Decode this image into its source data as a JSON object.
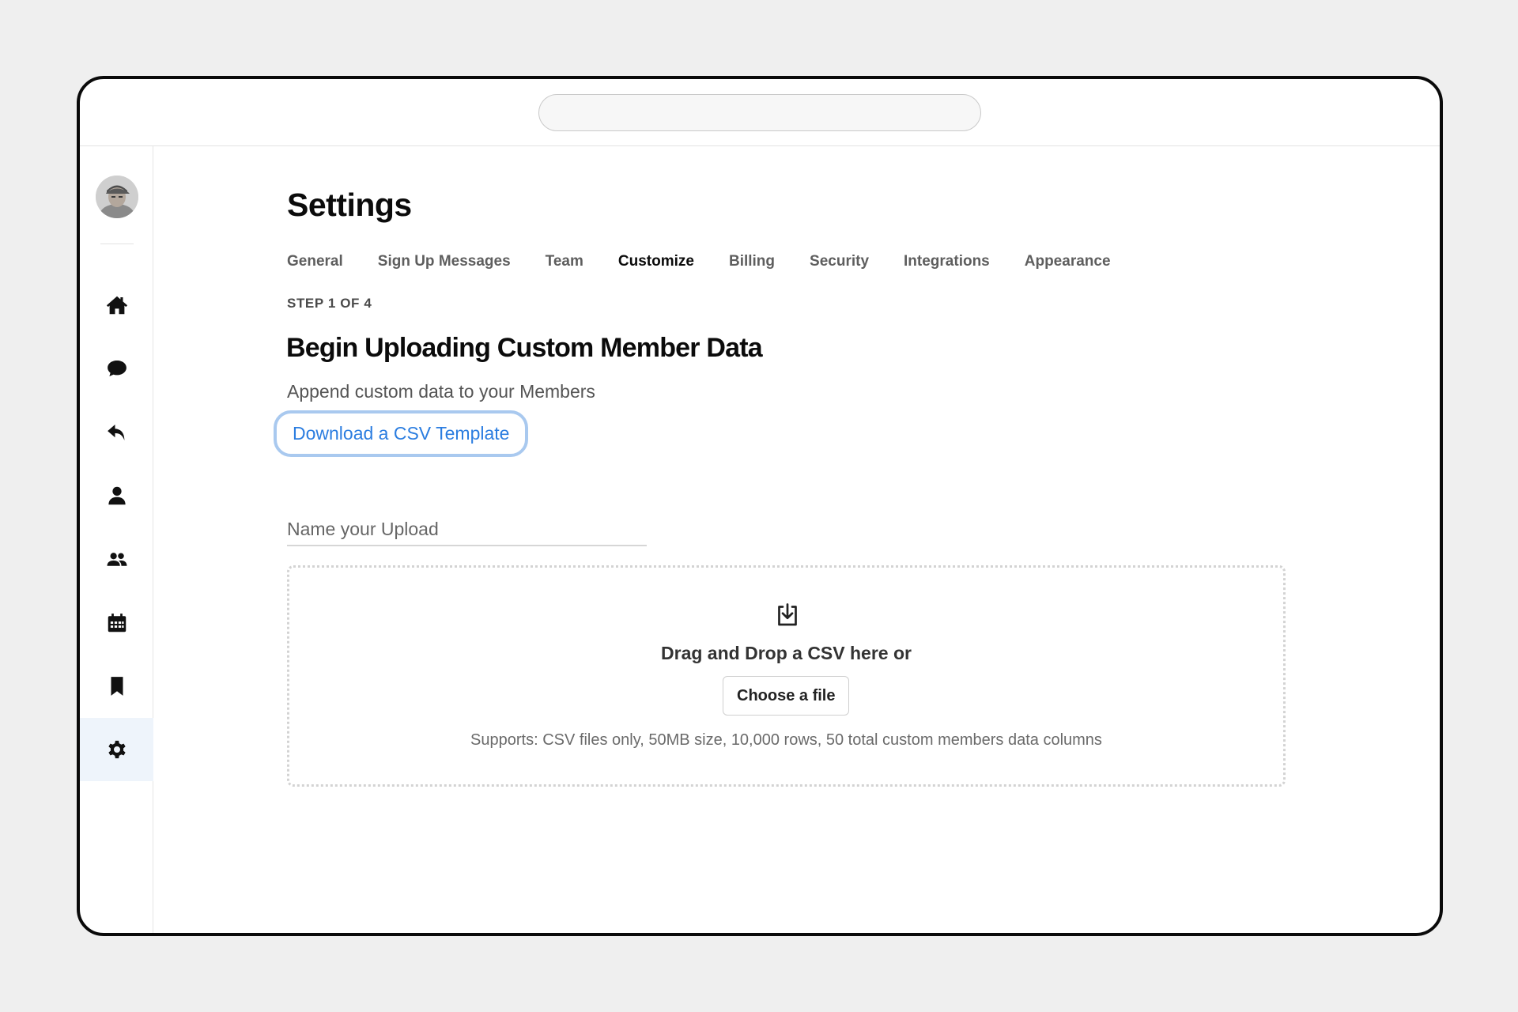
{
  "app": {
    "url_bar_value": ""
  },
  "sidebar": {
    "items": [
      {
        "icon": "home-icon",
        "label": "Home",
        "active": false
      },
      {
        "icon": "chat-bubble-icon",
        "label": "Messages",
        "active": false
      },
      {
        "icon": "reply-icon",
        "label": "Replies",
        "active": false
      },
      {
        "icon": "person-icon",
        "label": "Profile",
        "active": false
      },
      {
        "icon": "group-icon",
        "label": "Members",
        "active": false
      },
      {
        "icon": "calendar-icon",
        "label": "Calendar",
        "active": false
      },
      {
        "icon": "bookmark-icon",
        "label": "Bookmarks",
        "active": false
      },
      {
        "icon": "gear-icon",
        "label": "Settings",
        "active": true
      }
    ],
    "active_color": "#eef4fb"
  },
  "header": {
    "title": "Settings"
  },
  "tabs": [
    {
      "label": "General",
      "active": false
    },
    {
      "label": "Sign Up Messages",
      "active": false
    },
    {
      "label": "Team",
      "active": false
    },
    {
      "label": "Customize",
      "active": true
    },
    {
      "label": "Billing",
      "active": false
    },
    {
      "label": "Security",
      "active": false
    },
    {
      "label": "Integrations",
      "active": false
    },
    {
      "label": "Appearance",
      "active": false
    }
  ],
  "upload": {
    "step": "STEP 1 OF 4",
    "title": "Begin Uploading Custom Member Data",
    "subtitle": "Append custom data to your Members",
    "template_link": "Download a CSV Template",
    "name_placeholder": "Name your Upload",
    "name_value": "",
    "dropzone": {
      "icon": "download-tray-icon",
      "text": "Drag and Drop a CSV here or",
      "button": "Choose a file",
      "supports": "Supports: CSV files only, 50MB size, 10,000 rows, 50 total custom members data columns"
    }
  },
  "colors": {
    "accent_link": "#2b7de0",
    "focus_ring": "#a9c9ef"
  }
}
